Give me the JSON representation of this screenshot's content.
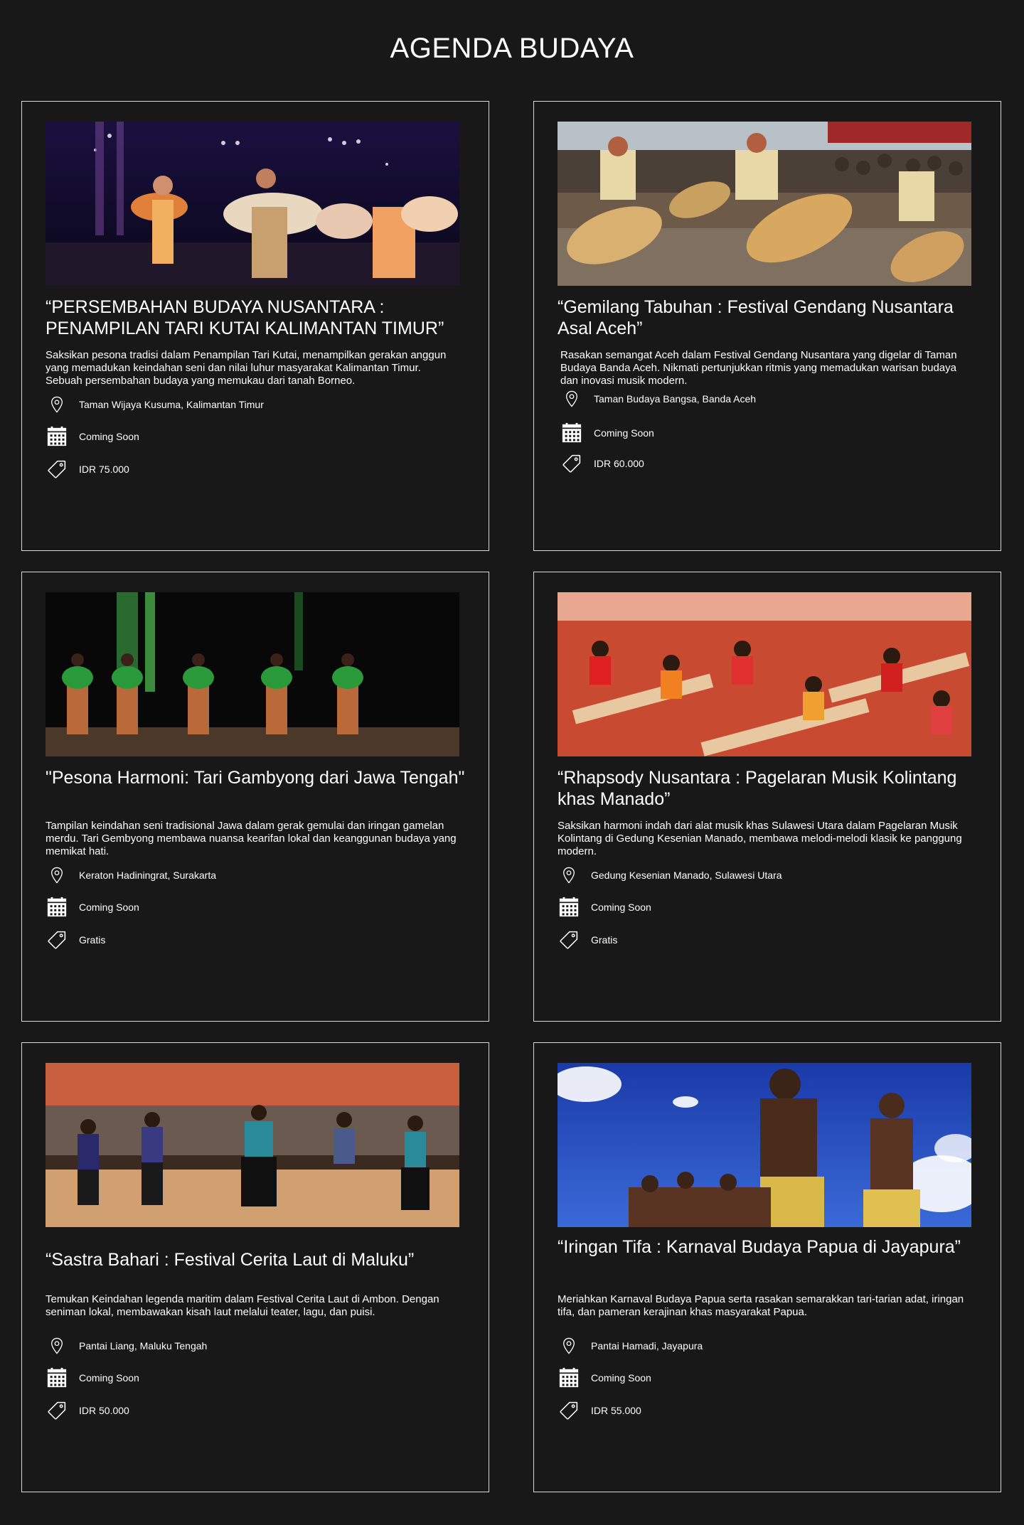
{
  "page": {
    "title": "AGENDA BUDAYA"
  },
  "events": [
    {
      "title": "“PERSEMBAHAN BUDAYA NUSANTARA : PENAMPILAN TARI KUTAI KALIMANTAN TIMUR”",
      "description": "Saksikan pesona tradisi dalam Penampilan Tari Kutai, menampilkan gerakan anggun yang memadukan keindahan seni dan nilai luhur masyarakat Kalimantan Timur. Sebuah persembahan budaya yang memukau dari tanah Borneo.",
      "location": "Taman Wijaya Kusuma, Kalimantan Timur",
      "date": "Coming Soon",
      "price": "IDR 75.000"
    },
    {
      "title": "“Gemilang Tabuhan : Festival Gendang Nusantara Asal Aceh”",
      "description": "Rasakan semangat Aceh dalam Festival Gendang Nusantara yang digelar di Taman Budaya Banda Aceh. Nikmati pertunjukkan ritmis yang memadukan warisan budaya dan inovasi musik modern.",
      "location": "Taman Budaya Bangsa, Banda Aceh",
      "date": "Coming Soon",
      "price": "IDR 60.000"
    },
    {
      "title": "\"Pesona Harmoni: Tari Gambyong dari Jawa Tengah\"",
      "description": "Tampilan keindahan seni tradisional Jawa dalam gerak gemulai dan iringan gamelan merdu. Tari Gembyong membawa nuansa kearifan lokal dan keanggunan budaya yang memikat hati.",
      "location": "Keraton Hadiningrat, Surakarta",
      "date": "Coming Soon",
      "price": "Gratis"
    },
    {
      "title": "“Rhapsody Nusantara : Pagelaran Musik Kolintang khas Manado”",
      "description": "Saksikan harmoni indah dari alat musik khas Sulawesi Utara dalam Pagelaran Musik Kolintang di Gedung Kesenian Manado, membawa melodi-melodi klasik ke panggung modern.",
      "location": "Gedung Kesenian Manado, Sulawesi Utara",
      "date": "Coming Soon",
      "price": "Gratis"
    },
    {
      "title": "“Sastra Bahari : Festival Cerita Laut di Maluku”",
      "description": "Temukan Keindahan legenda maritim dalam Festival Cerita Laut di Ambon. Dengan seniman lokal, membawakan kisah laut melalui teater, lagu, dan puisi.",
      "location": "Pantai Liang, Maluku Tengah",
      "date": "Coming Soon",
      "price": "IDR 50.000"
    },
    {
      "title": "“Iringan Tifa : Karnaval Budaya Papua di Jayapura”",
      "description": "Meriahkan Karnaval Budaya Papua serta rasakan semarakkan tari-tarian adat, iringan tifa, dan pameran kerajinan khas masyarakat Papua.",
      "location": "Pantai Hamadi, Jayapura",
      "date": "Coming Soon",
      "price": "IDR 55.000"
    }
  ],
  "icons": {
    "location": "map-pin-icon",
    "date": "calendar-icon",
    "price": "price-tag-icon"
  },
  "colors": {
    "background": "#181818",
    "card_border": "#d8d8d8",
    "text": "#ffffff"
  }
}
